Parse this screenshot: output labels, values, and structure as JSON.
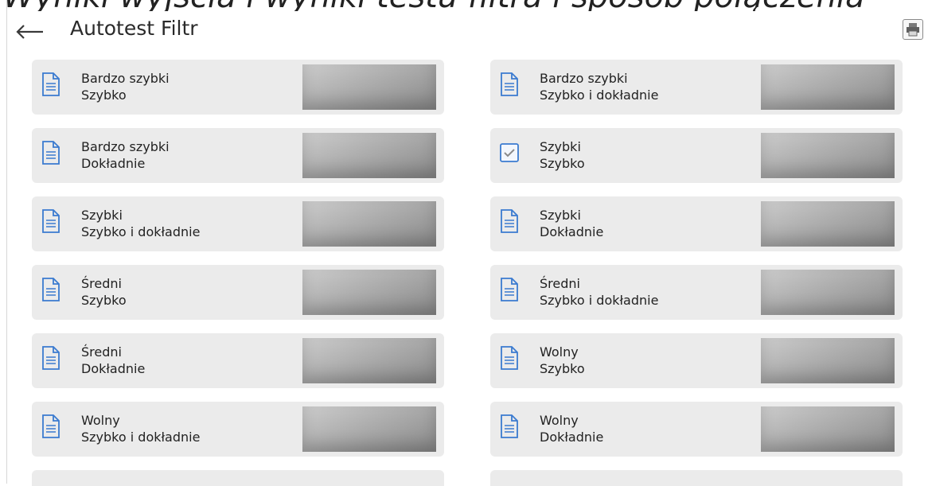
{
  "header": {
    "top_fragment": "Wyniki wyjścia i wyniki testu filtra i sposób połączenia",
    "title": "Autotest Filtr"
  },
  "icons": {
    "back": "arrow-left-icon",
    "print": "printer-icon",
    "document": "document-icon",
    "check": "checkbox-checked-icon"
  },
  "colors": {
    "accent": "#3b7bd0",
    "card_bg": "#ebebeb"
  },
  "results": [
    {
      "line1": "Bardzo szybki",
      "line2": "Szybko",
      "status": "document"
    },
    {
      "line1": "Bardzo szybki",
      "line2": "Szybko i dokładnie",
      "status": "document"
    },
    {
      "line1": "Bardzo szybki",
      "line2": "Dokładnie",
      "status": "document"
    },
    {
      "line1": "Szybki",
      "line2": "Szybko",
      "status": "checked"
    },
    {
      "line1": "Szybki",
      "line2": "Szybko i dokładnie",
      "status": "document"
    },
    {
      "line1": "Szybki",
      "line2": "Dokładnie",
      "status": "document"
    },
    {
      "line1": "Średni",
      "line2": "Szybko",
      "status": "document"
    },
    {
      "line1": "Średni",
      "line2": "Szybko i dokładnie",
      "status": "document"
    },
    {
      "line1": "Średni",
      "line2": "Dokładnie",
      "status": "document"
    },
    {
      "line1": "Wolny",
      "line2": "Szybko",
      "status": "document"
    },
    {
      "line1": "Wolny",
      "line2": "Szybko i dokładnie",
      "status": "document"
    },
    {
      "line1": "Wolny",
      "line2": "Dokładnie",
      "status": "document"
    }
  ]
}
